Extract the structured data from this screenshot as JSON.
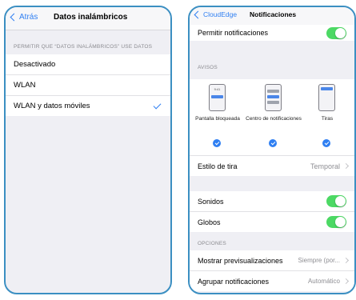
{
  "left_screen": {
    "back_label": "Atrás",
    "title": "Datos inalámbricos",
    "section_header": "PERMITIR QUE “DATOS INALÁMBRICOS” USE DATOS",
    "options": [
      {
        "label": "Desactivado",
        "selected": false
      },
      {
        "label": "WLAN",
        "selected": false
      },
      {
        "label": "WLAN y datos móviles",
        "selected": true
      }
    ]
  },
  "right_screen": {
    "back_label": "CloudEdge",
    "title": "Notificaciones",
    "allow_notifications": {
      "label": "Permitir notificaciones",
      "enabled": true
    },
    "alerts_header": "AVISOS",
    "alert_styles": [
      {
        "label": "Pantalla bloqueada",
        "time": "9:41",
        "checked": true
      },
      {
        "label": "Centro de notificaciones",
        "checked": true
      },
      {
        "label": "Tiras",
        "checked": true
      }
    ],
    "banner_style": {
      "label": "Estilo de tira",
      "value": "Temporal"
    },
    "sounds": {
      "label": "Sonidos",
      "enabled": true
    },
    "badges": {
      "label": "Globos",
      "enabled": true
    },
    "options_header": "OPCIONES",
    "show_previews": {
      "label": "Mostrar previsualizaciones",
      "value": "Siempre (por..."
    },
    "grouping": {
      "label": "Agrupar notificaciones",
      "value": "Automático"
    }
  },
  "colors": {
    "accent": "#2f7ff2",
    "toggle_on": "#4cd964",
    "frame": "#3b8fc2"
  }
}
